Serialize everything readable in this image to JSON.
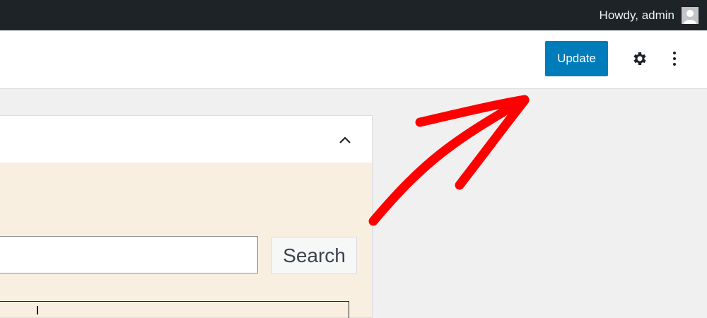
{
  "admin_bar": {
    "greeting": "Howdy, admin",
    "avatar_icon": "user-avatar-icon"
  },
  "toolbar": {
    "update_label": "Update",
    "settings_icon": "gear-icon",
    "options_icon": "vertical-ellipsis-icon"
  },
  "panel": {
    "collapse_icon": "chevron-up-icon",
    "search_value": "",
    "search_button_label": "Search"
  },
  "colors": {
    "admin_bar_bg": "#1d2327",
    "accent": "#007cba",
    "panel_bg": "#f9efe0",
    "canvas_bg": "#f0f0f1",
    "annotation_arrow": "#ff0000"
  }
}
